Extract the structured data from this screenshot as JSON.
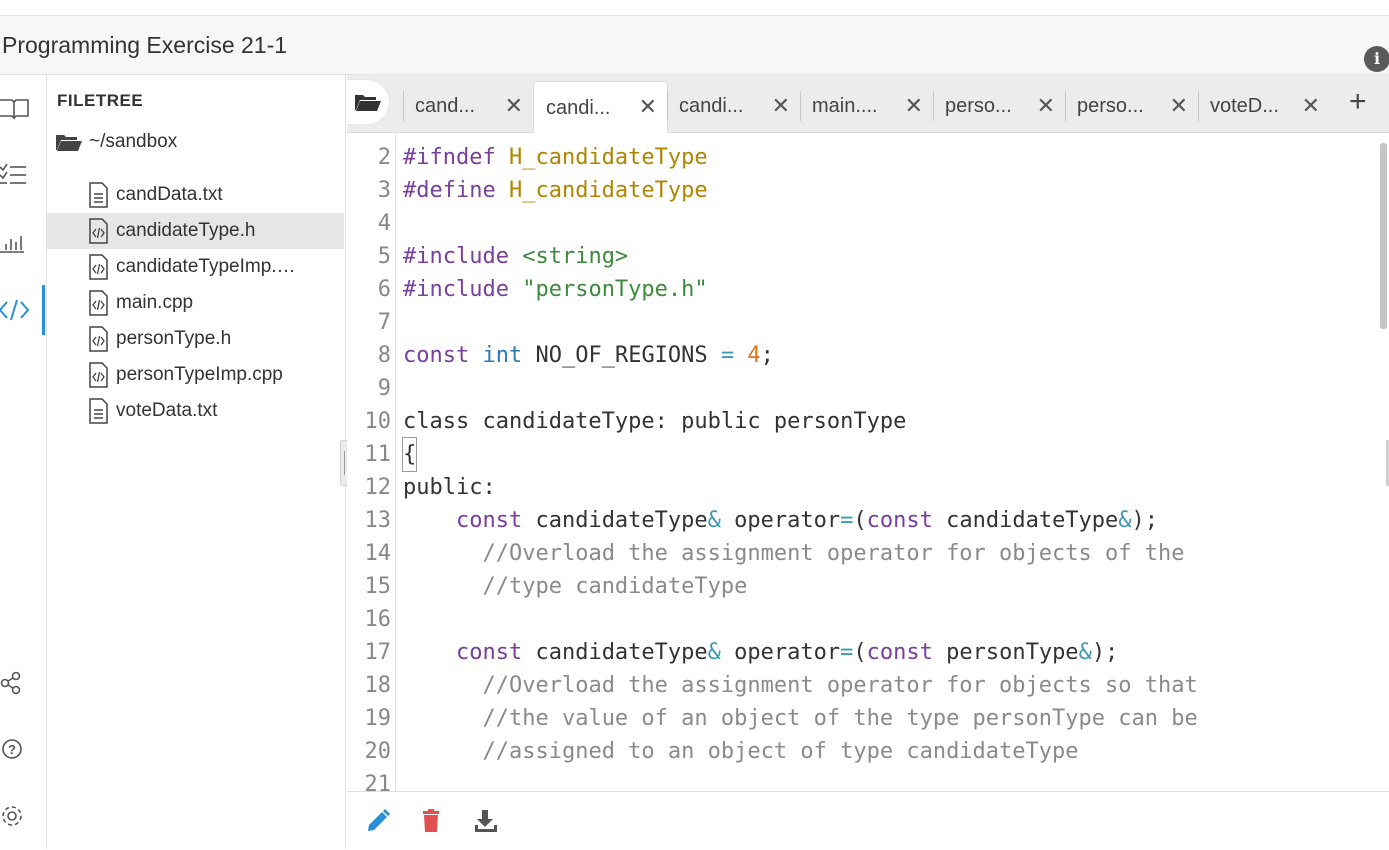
{
  "app": {
    "title": "Programming Exercise 21-1"
  },
  "rail": {
    "icons": [
      "book-icon",
      "checklist-icon",
      "chart-icon",
      "code-icon",
      "share-icon",
      "help-icon",
      "settings-icon"
    ],
    "active": "code-icon",
    "accent": "#2a8fd6"
  },
  "filetree": {
    "header": "FILETREE",
    "root": "~/sandbox",
    "files": [
      {
        "name": "candData.txt",
        "type": "text"
      },
      {
        "name": "candidateType.h",
        "type": "code",
        "selected": true
      },
      {
        "name": "candidateTypeImp.cpp",
        "type": "code"
      },
      {
        "name": "main.cpp",
        "type": "code"
      },
      {
        "name": "personType.h",
        "type": "code"
      },
      {
        "name": "personTypeImp.cpp",
        "type": "code"
      },
      {
        "name": "voteData.txt",
        "type": "text"
      }
    ]
  },
  "tabs": [
    {
      "label": "cand...",
      "active": false
    },
    {
      "label": "candi...",
      "active": true
    },
    {
      "label": "candi...",
      "active": false
    },
    {
      "label": "main....",
      "active": false
    },
    {
      "label": "perso...",
      "active": false
    },
    {
      "label": "perso...",
      "active": false
    },
    {
      "label": "voteD...",
      "active": false
    }
  ],
  "tab_close": "✕",
  "tab_add": "+",
  "editor": {
    "line_numbers": [
      "2",
      "3",
      "4",
      "5",
      "6",
      "7",
      "8",
      "9",
      "10",
      "11",
      "12",
      "13",
      "14",
      "15",
      "16",
      "17",
      "18",
      "19",
      "20",
      "21"
    ]
  },
  "bottom": {
    "buttons": [
      "edit-icon",
      "delete-icon",
      "download-icon"
    ],
    "colors": {
      "edit": "#2a8fd6",
      "delete": "#e05252",
      "download": "#555555"
    }
  }
}
